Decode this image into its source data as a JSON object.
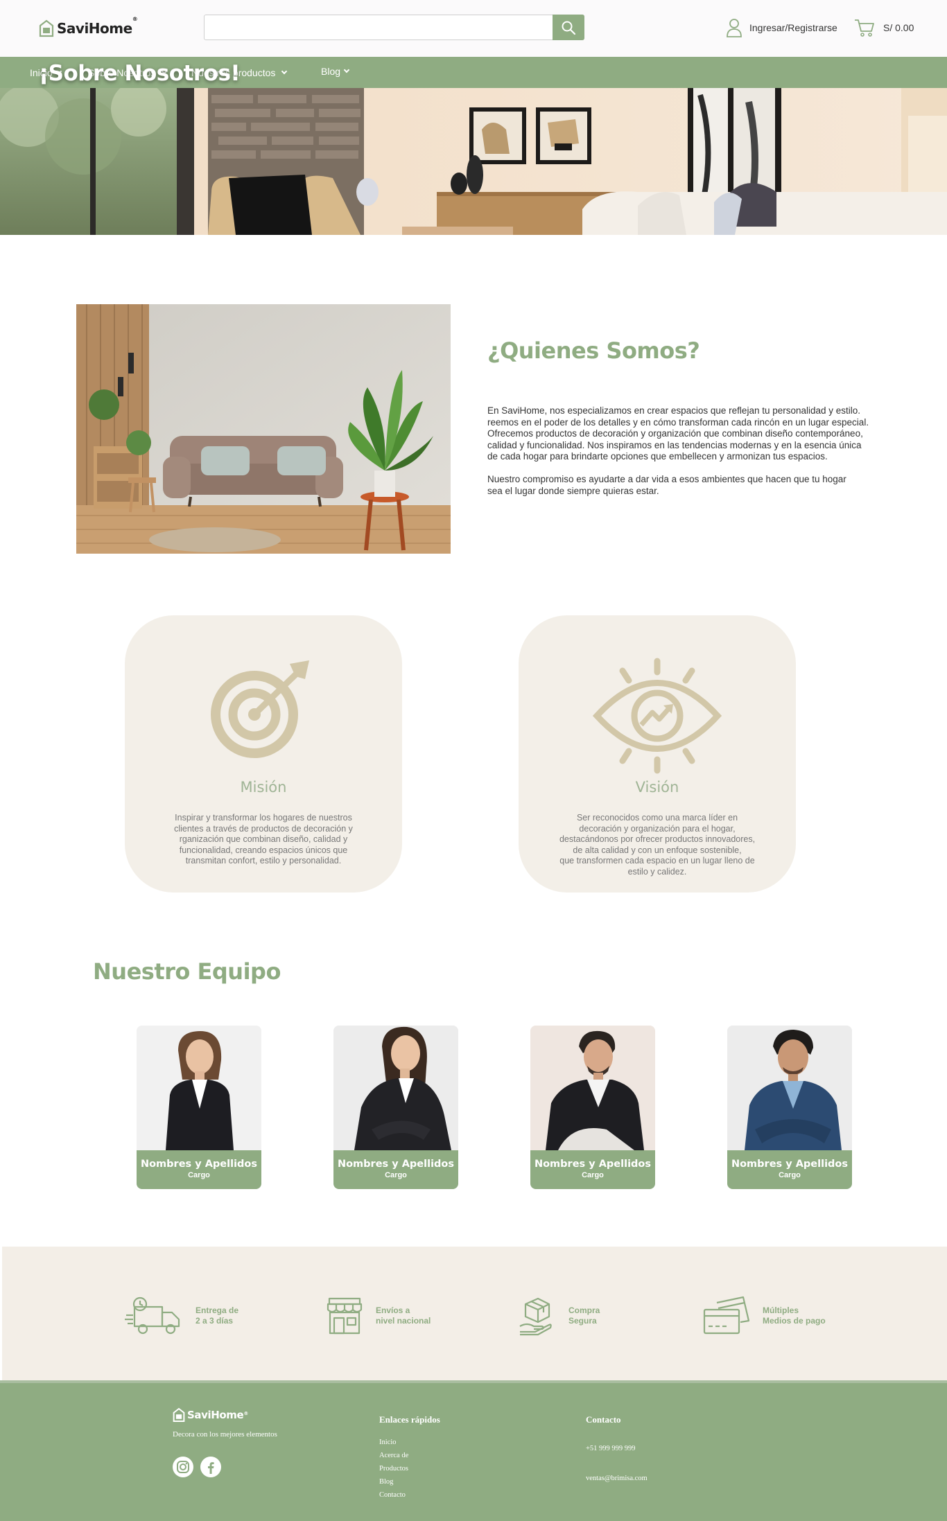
{
  "header": {
    "logo_text": "SaviHome",
    "logo_mark": "®",
    "search_placeholder": "",
    "account_label": "Ingresar/Registrarse",
    "cart_total": "S/ 0.00"
  },
  "nav": {
    "items": [
      {
        "label": "Inicio"
      },
      {
        "label": "Sobre Nosotros"
      },
      {
        "label": "Nuestros productos"
      },
      {
        "label": "Blog"
      }
    ]
  },
  "hero": {
    "title": "¡Sobre Nosotros!"
  },
  "about": {
    "title": "¿Quienes Somos?",
    "p1_lines": [
      "En SaviHome, nos especializamos en crear espacios que reflejan tu personalidad y estilo.",
      "reemos en el poder de los detalles y en cómo transforman cada rincón en un lugar especial.",
      "Ofrecemos productos de decoración y organización que combinan diseño contemporáneo,",
      "calidad y funcionalidad. Nos inspiramos en las tendencias modernas y en la esencia única",
      "de cada hogar para brindarte opciones que embellecen y armonizan tus espacios."
    ],
    "p2_lines": [
      "Nuestro compromiso es ayudarte a dar vida a esos ambientes que hacen que tu hogar",
      "sea el lugar donde siempre quieras estar."
    ]
  },
  "mission": {
    "title": "Misión",
    "lines": [
      "Inspirar y transformar los hogares de nuestros",
      "clientes a través de productos de decoración y",
      "rganización que combinan diseño, calidad y",
      "funcionalidad, creando espacios únicos que",
      "transmitan confort, estilo y personalidad."
    ],
    "icon": "target-icon"
  },
  "vision": {
    "title": "Visión",
    "lines": [
      "Ser reconocidos como una marca líder en",
      "decoración y organización para el hogar,",
      "destacándonos por ofrecer productos innovadores,",
      "de alta calidad y con un enfoque sostenible,",
      "que transformen cada espacio en un lugar lleno de",
      "estilo y calidez."
    ],
    "icon": "eye-growth-icon"
  },
  "team": {
    "title": "Nuestro Equipo",
    "members": [
      {
        "name": "Nombres y Apellidos",
        "role": "Cargo"
      },
      {
        "name": "Nombres y Apellidos",
        "role": "Cargo"
      },
      {
        "name": "Nombres y Apellidos",
        "role": "Cargo"
      },
      {
        "name": "Nombres y Apellidos",
        "role": "Cargo"
      }
    ]
  },
  "features": [
    {
      "line1": "Entrega de",
      "line2": "2 a 3 días",
      "icon": "delivery-truck-icon"
    },
    {
      "line1": "Envíos a",
      "line2": "nivel nacional",
      "icon": "store-icon"
    },
    {
      "line1": "Compra",
      "line2": "Segura",
      "icon": "secure-package-icon"
    },
    {
      "line1": "Múltiples",
      "line2": "Medios de pago",
      "icon": "credit-card-icon"
    }
  ],
  "footer": {
    "logo_text": "SaviHome",
    "logo_mark": "®",
    "tagline": "Decora con los mejores elementos",
    "links_title": "Enlaces rápidos",
    "links": [
      "Inicio",
      "Acerca de",
      "Productos",
      "Blog",
      "Contacto"
    ],
    "contact_title": "Contacto",
    "phone": "+51 999 999 999",
    "email": "ventas@brimisa.com"
  },
  "colors": {
    "brand_green": "#8fac82",
    "beige": "#f3efe8",
    "icon_tan": "#d2c7a8"
  }
}
